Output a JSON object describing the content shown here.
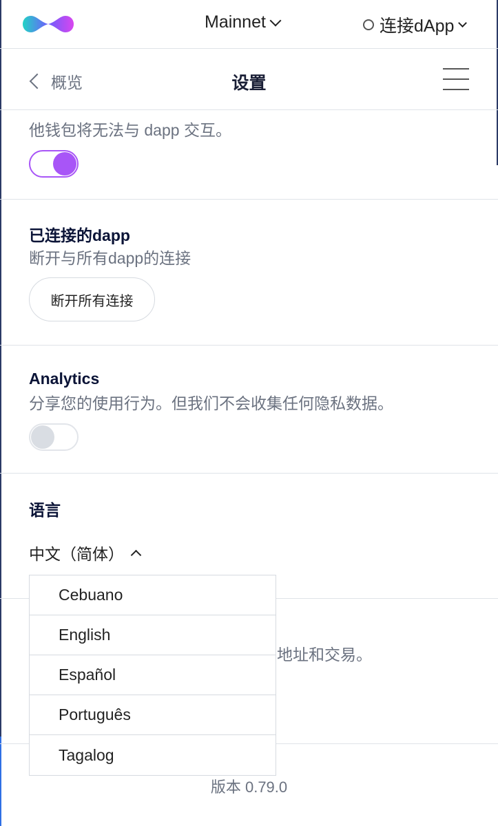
{
  "topbar": {
    "network_label": "Mainnet",
    "connect_label": "连接dApp"
  },
  "header": {
    "back_label": "概览",
    "title": "设置"
  },
  "privacy_section": {
    "desc_partial": "他钱包将无法与 dapp 交互。",
    "toggle_on": true
  },
  "connected_dapps": {
    "title": "已连接的dapp",
    "desc": "断开与所有dapp的连接",
    "button_label": "断开所有连接"
  },
  "analytics": {
    "title": "Analytics",
    "desc": "分享您的使用行为。但我们不会收集任何隐私数据。",
    "toggle_on": false
  },
  "language": {
    "title": "语言",
    "selected": "中文（简体）",
    "options": [
      "Cebuano",
      "English",
      "Español",
      "Português",
      "Tagalog"
    ]
  },
  "hidden_section": {
    "desc_partial": "地址和交易。"
  },
  "footer": {
    "version": "版本 0.79.0"
  },
  "colors": {
    "accent": "#a855f7",
    "divider": "#dfe3e8",
    "muted_text": "#6b7280",
    "heading_text": "#0b1437"
  }
}
